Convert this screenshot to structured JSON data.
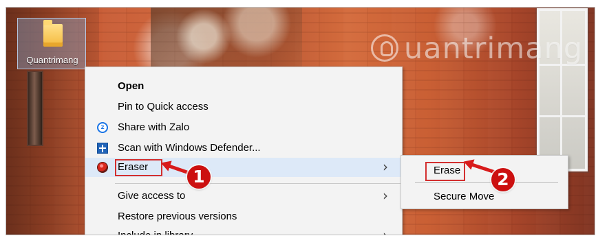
{
  "desktop": {
    "folder_label": "Quantrimang",
    "watermark": "uantrimang"
  },
  "context_menu": {
    "items": [
      {
        "label": "Open"
      },
      {
        "label": "Pin to Quick access"
      },
      {
        "label": "Share with Zalo",
        "icon": "zalo-icon"
      },
      {
        "label": "Scan with Windows Defender...",
        "icon": "windows-defender-icon"
      },
      {
        "label": "Eraser",
        "icon": "eraser-icon",
        "submenu": true
      },
      {
        "label": "Give access to",
        "submenu": true
      },
      {
        "label": "Restore previous versions"
      },
      {
        "label": "Include in library",
        "submenu": true
      }
    ]
  },
  "submenu": {
    "items": [
      {
        "label": "Erase"
      },
      {
        "label": "Secure Move"
      }
    ]
  },
  "annotations": [
    {
      "number": "1"
    },
    {
      "number": "2"
    }
  ],
  "colors": {
    "highlight": "#d32f2f",
    "menu_background": "#f3f3f3",
    "folder": "#f4b93c"
  }
}
